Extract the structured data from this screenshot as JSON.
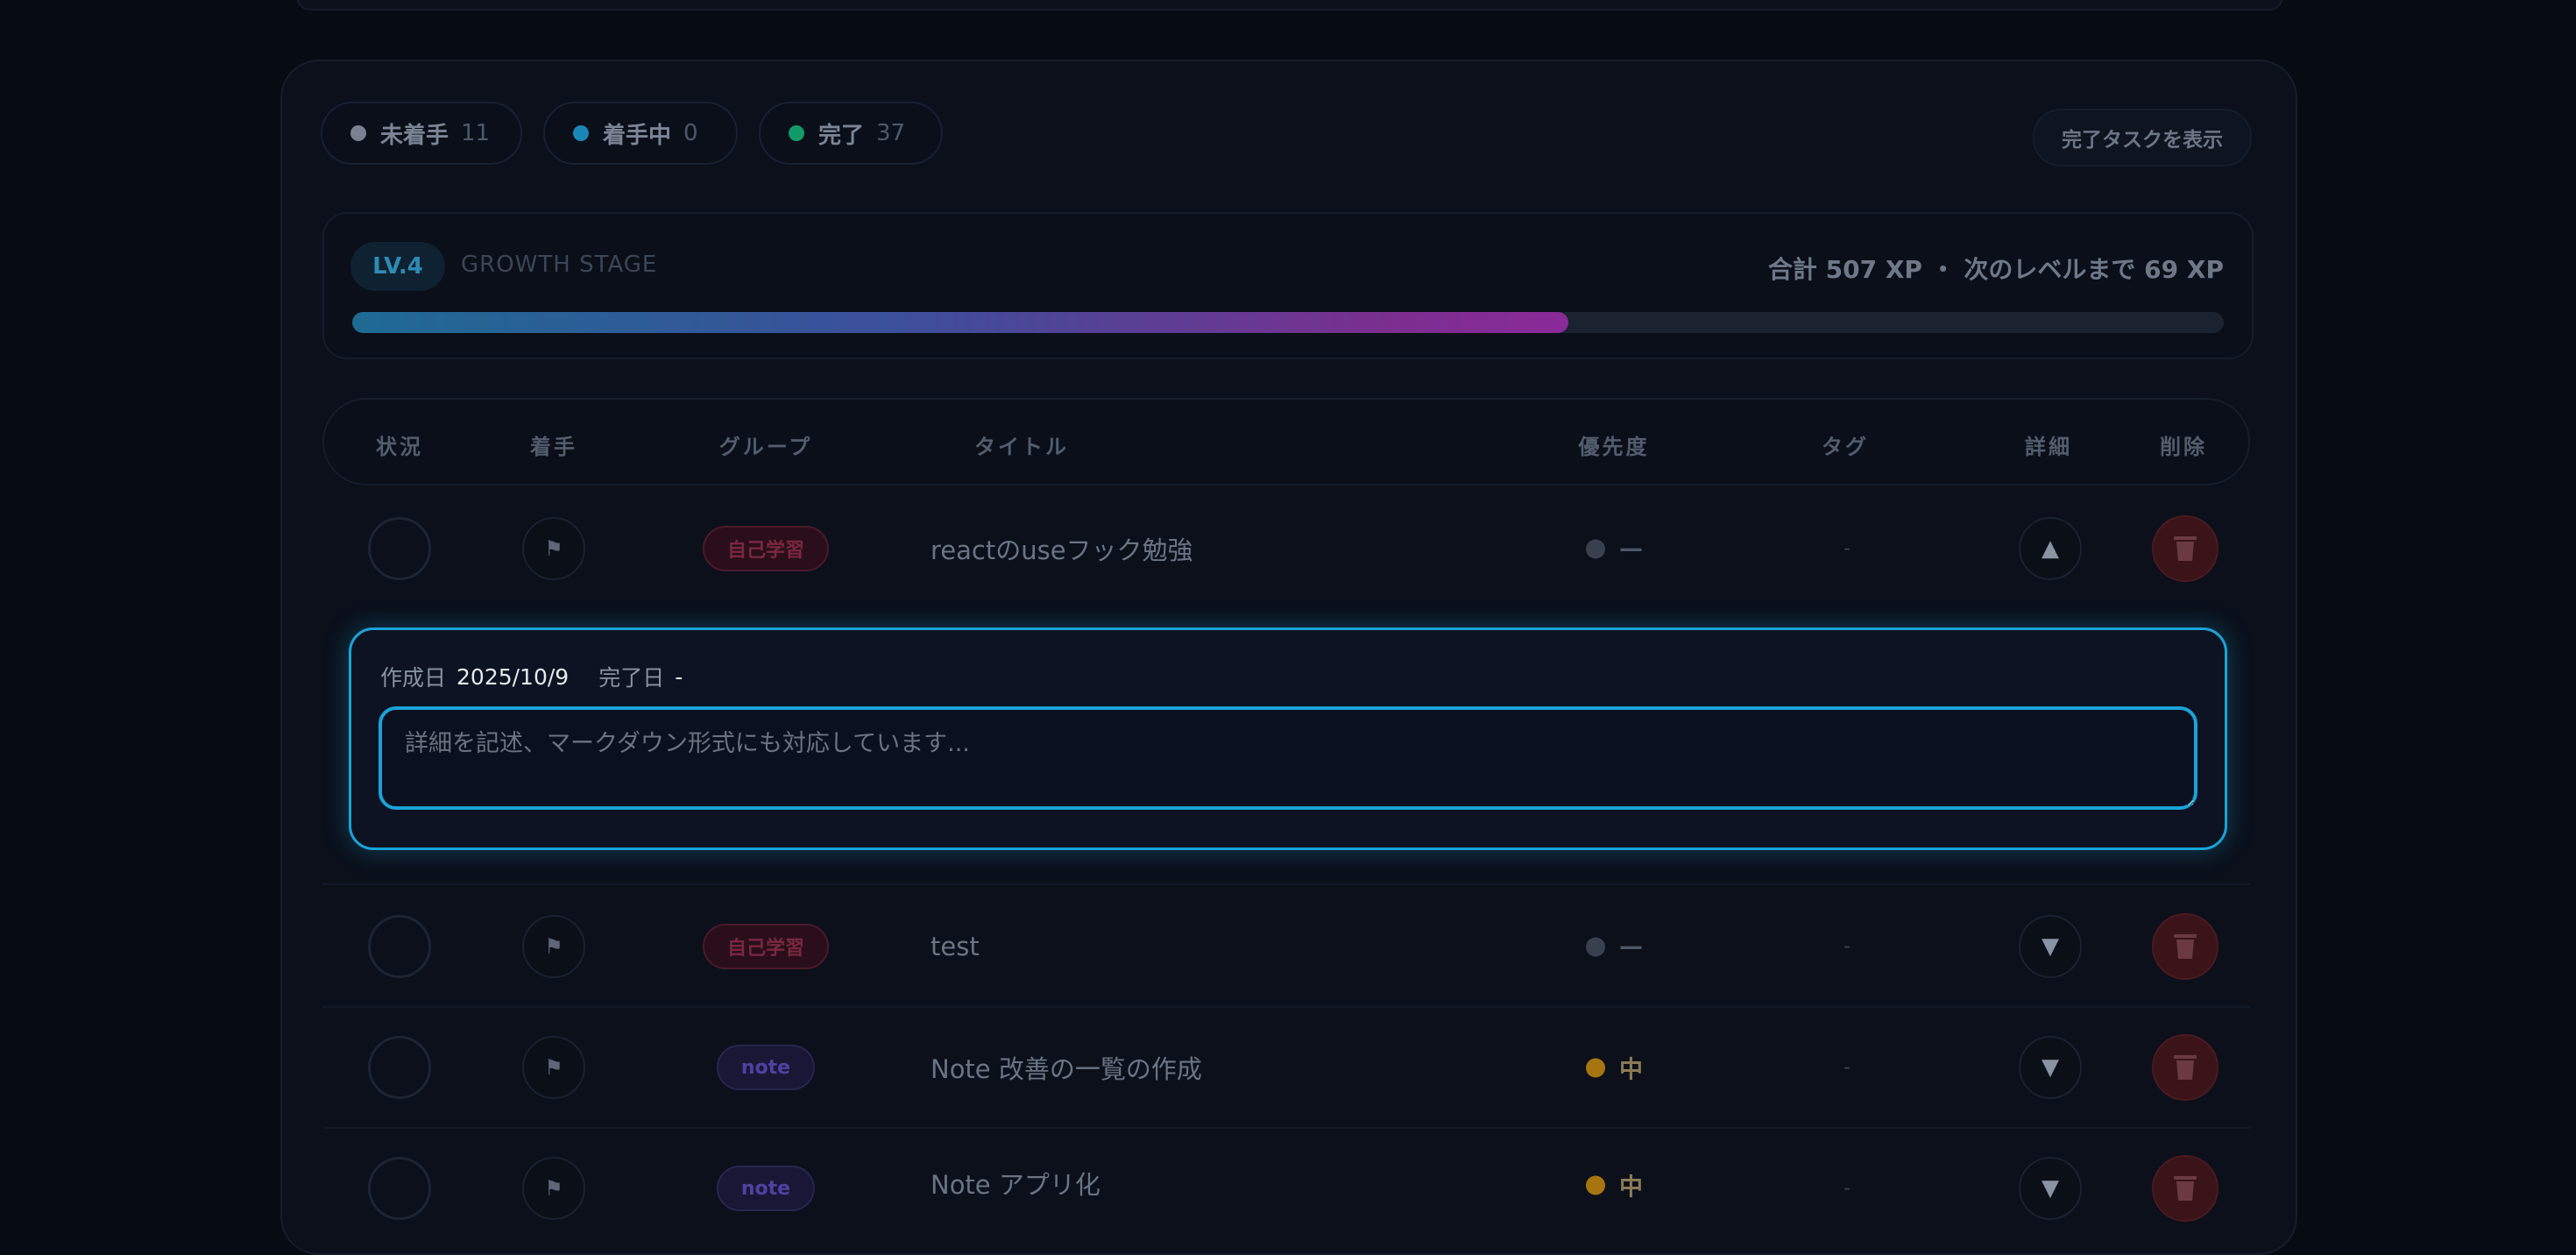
{
  "summary": {
    "todo_label": "未着手",
    "todo_count": "11",
    "todo_color": "#7b8190",
    "doing_label": "着手中",
    "doing_count": "0",
    "doing_color": "#1a87b8",
    "done_label": "完了",
    "done_count": "37",
    "done_color": "#129b68",
    "show_done_label": "完了タスクを表示"
  },
  "level": {
    "badge": "LV.4",
    "stage": "GROWTH STAGE",
    "xp_text": "合計 507 XP ・ 次のレベルまで 69 XP",
    "progress_fraction": 0.65
  },
  "table": {
    "headers": {
      "status": "状況",
      "start": "着手",
      "group": "グループ",
      "title": "タイトル",
      "priority": "優先度",
      "tags": "タグ",
      "details": "詳細",
      "delete": "削除"
    },
    "rows": [
      {
        "group": "自己学習",
        "title": "reactのuseフック勉強",
        "priority": "—",
        "tags": "-",
        "toggle": "▲",
        "priority_color": "#3a414e"
      },
      {
        "group": "自己学習",
        "title": "test",
        "priority": "—",
        "tags": "-",
        "toggle": "▼",
        "priority_color": "#3a414e"
      },
      {
        "group": "note",
        "title": "Note 改善の一覧の作成",
        "priority": "中",
        "tags": "-",
        "toggle": "▼",
        "priority_color": "#a7750f"
      },
      {
        "group": "note",
        "title": "Note アプリ化",
        "priority": "中",
        "tags": "-",
        "toggle": "▼",
        "priority_color": "#a7750f"
      }
    ]
  },
  "detail": {
    "created_label": "作成日",
    "created_value": "2025/10/9",
    "completed_label": "完了日",
    "completed_value": "-",
    "placeholder": "詳細を記述、マークダウン形式にも対応しています..."
  },
  "icons": {
    "flag": "flag-icon",
    "trash": "trash-icon",
    "expand": "chevron-up-icon",
    "collapse": "chevron-down-icon"
  }
}
